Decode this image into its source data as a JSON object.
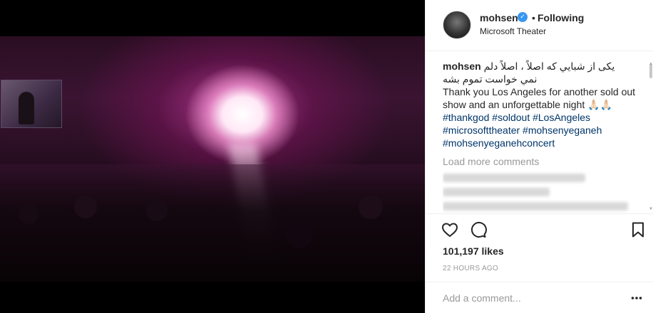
{
  "header": {
    "username": "mohsen",
    "dot": "•",
    "follow_label": "Following",
    "location": "Microsoft Theater"
  },
  "caption": {
    "username": "mohsen",
    "persian_line_1": "یکی از شبايي که اصلاً ، اصلاً دلم",
    "persian_line_2": "نمي خواست تموم بشه",
    "english_line_1": "Thank you Los Angeles for another sold out",
    "english_line_2": "show and an unforgettable night 🙏🏻🙏🏻",
    "hashtags": [
      "#thankgod #soldout #LosAngeles",
      "#microsofttheater #mohsenyeganeh",
      "#mohsenyeganehconcert"
    ]
  },
  "comments": {
    "load_more_label": "Load more comments"
  },
  "actions": {
    "icons": [
      "heart-icon",
      "comment-icon",
      "bookmark-icon"
    ]
  },
  "likes": {
    "count": "101,197",
    "word": "likes"
  },
  "timestamp": "22 HOURS AGO",
  "comment_box": {
    "placeholder": "Add a comment..."
  },
  "colors": {
    "verified": "#3897f0",
    "hashtag": "#003569",
    "muted": "#999999",
    "text": "#262626"
  }
}
